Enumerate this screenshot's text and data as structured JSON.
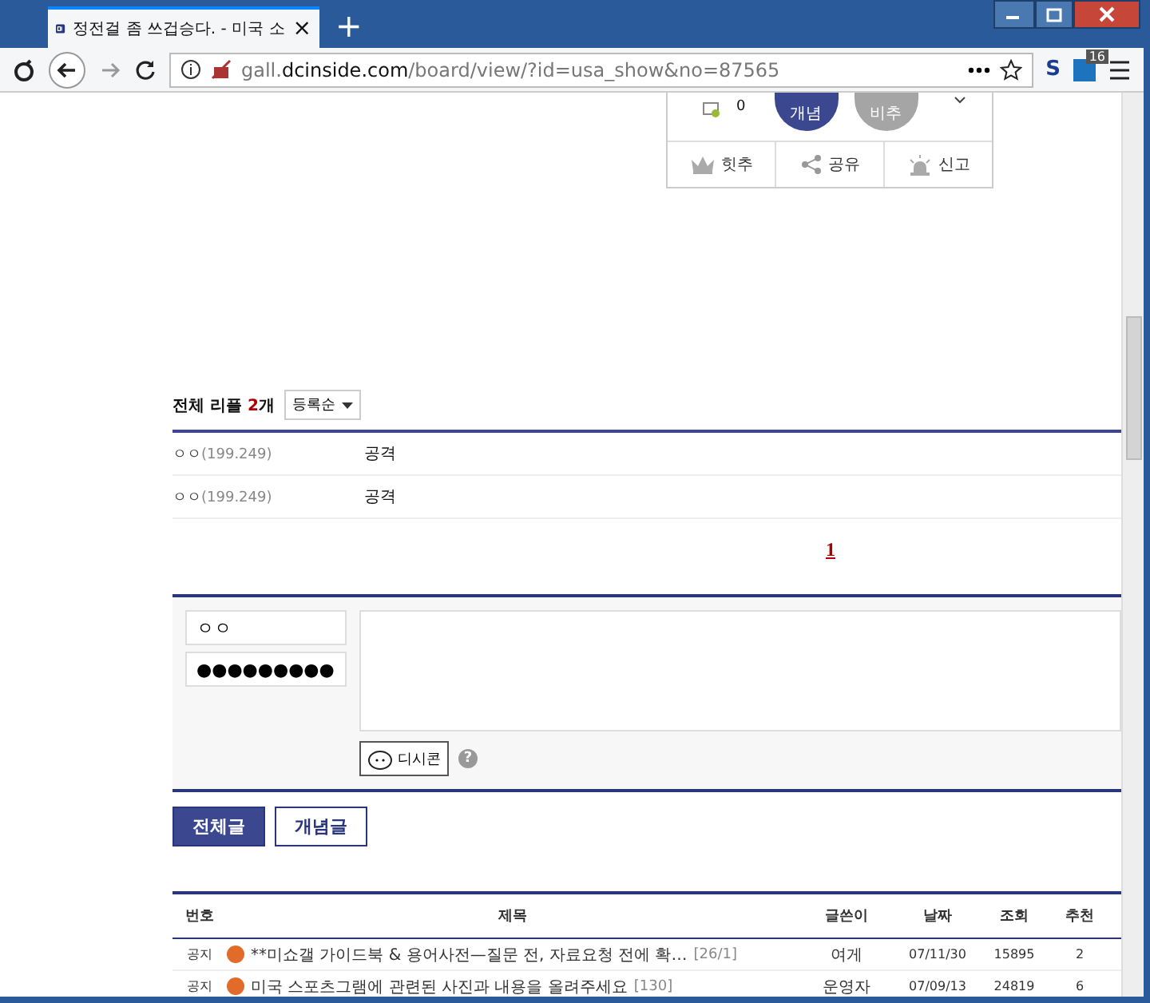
{
  "browser": {
    "tab_title": "정전걸 좀 쓰겁승다. - 미국 소",
    "tab_close": "×",
    "new_tab": "+",
    "url_prefix": "gall.",
    "url_domain": "dcinside.com",
    "url_path": "/board/view/?id=usa_show&no=87565",
    "extension_label": "S",
    "extension_badge": "16"
  },
  "post_actions": {
    "recommend_count": "0",
    "vote_buttons": [
      {
        "label": "개념",
        "kind": "up"
      },
      {
        "label": "비추",
        "kind": "down"
      }
    ],
    "actions": [
      {
        "label": "힛추",
        "kind": "crown"
      },
      {
        "label": "공유",
        "kind": "share"
      },
      {
        "label": "신고",
        "kind": "siren"
      }
    ]
  },
  "comments": {
    "title": "전체 리플",
    "count": "2",
    "unit": "개",
    "sort": "등록순",
    "items": [
      {
        "name": "ㅇㅇ",
        "ip": "(199.249)",
        "text": "공격"
      },
      {
        "name": "ㅇㅇ",
        "ip": "(199.249)",
        "text": "공격"
      }
    ],
    "pages": [
      {
        "label": "1",
        "selected": true
      }
    ]
  },
  "comment_form": {
    "name": "ㅇㅇ",
    "password": "●●●●●●●●●",
    "dccon": "디시콘",
    "help": "?"
  },
  "list_tabs": [
    {
      "label": "전체글",
      "selected": true
    },
    {
      "label": "개념글",
      "selected": false
    }
  ],
  "table": {
    "columns": [
      "번호",
      "제목",
      "글쓴이",
      "날짜",
      "조회",
      "추천"
    ],
    "rows": [
      {
        "number": "공지",
        "title": "**미쇼갤 가이드북 & 용어사전—질문 전, 자료요청 전에 확…",
        "replies": "[26/1]",
        "writer": "여게",
        "date": "07/11/30",
        "views": "15895",
        "recommend": "2"
      },
      {
        "number": "공지",
        "title": "미국 스포츠그램에 관련된 사진과 내용을 올려주세요",
        "replies": "[130]",
        "writer": "운영자",
        "date": "07/09/13",
        "views": "24819",
        "recommend": "6"
      }
    ]
  }
}
